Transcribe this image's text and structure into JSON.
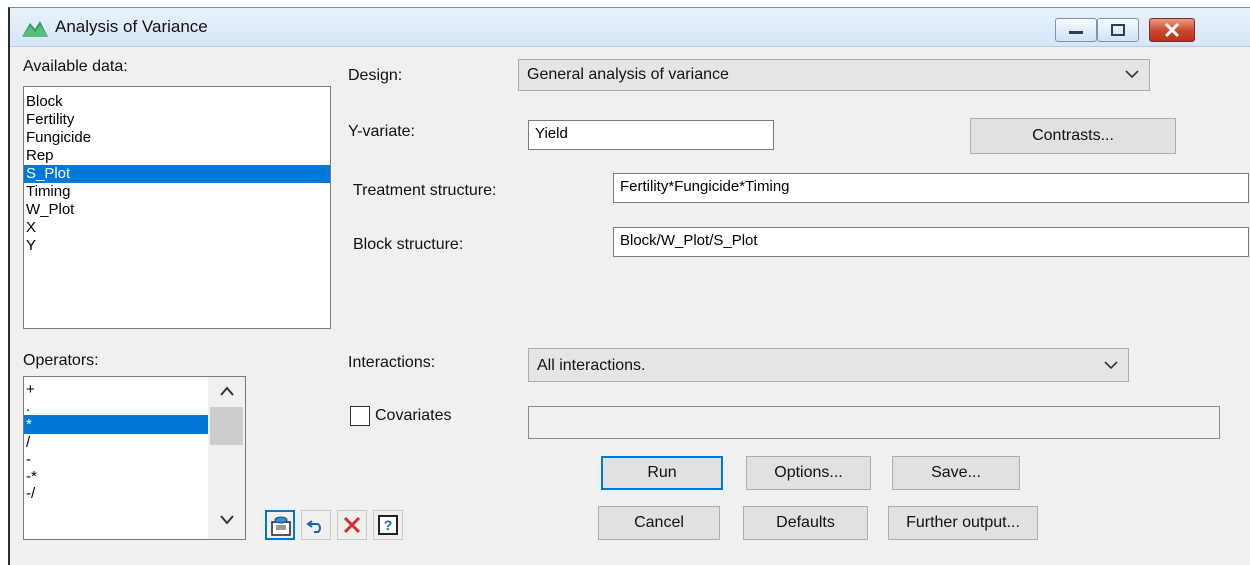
{
  "window": {
    "title": "Analysis of Variance"
  },
  "available_data": {
    "label": "Available data:",
    "items": [
      "Block",
      "Fertility",
      "Fungicide",
      "Rep",
      "S_Plot",
      "Timing",
      "W_Plot",
      "X",
      "Y"
    ],
    "selected": "S_Plot"
  },
  "operators": {
    "label": "Operators:",
    "items": [
      "+",
      ".",
      "*",
      "/",
      "-",
      "-*",
      "-/"
    ],
    "selected": "*"
  },
  "design": {
    "label": "Design:",
    "value": "General analysis of variance"
  },
  "y_variate": {
    "label": "Y-variate:",
    "value": "Yield"
  },
  "contrasts_button": "Contrasts...",
  "treatment_structure": {
    "label": "Treatment structure:",
    "value": "Fertility*Fungicide*Timing"
  },
  "block_structure": {
    "label": "Block structure:",
    "value": "Block/W_Plot/S_Plot"
  },
  "interactions": {
    "label": "Interactions:",
    "value": "All interactions."
  },
  "covariates": {
    "label": "Covariates",
    "checked": false,
    "value": ""
  },
  "buttons": {
    "run": "Run",
    "options": "Options...",
    "save": "Save...",
    "cancel": "Cancel",
    "defaults": "Defaults",
    "further_output": "Further output..."
  },
  "toolbar_icons": [
    "save-to-list-icon",
    "undo-icon",
    "clear-icon",
    "help-icon"
  ],
  "colors": {
    "selection": "#0078d7",
    "close": "#c9462d",
    "titlebar": "#d6e6f7"
  }
}
